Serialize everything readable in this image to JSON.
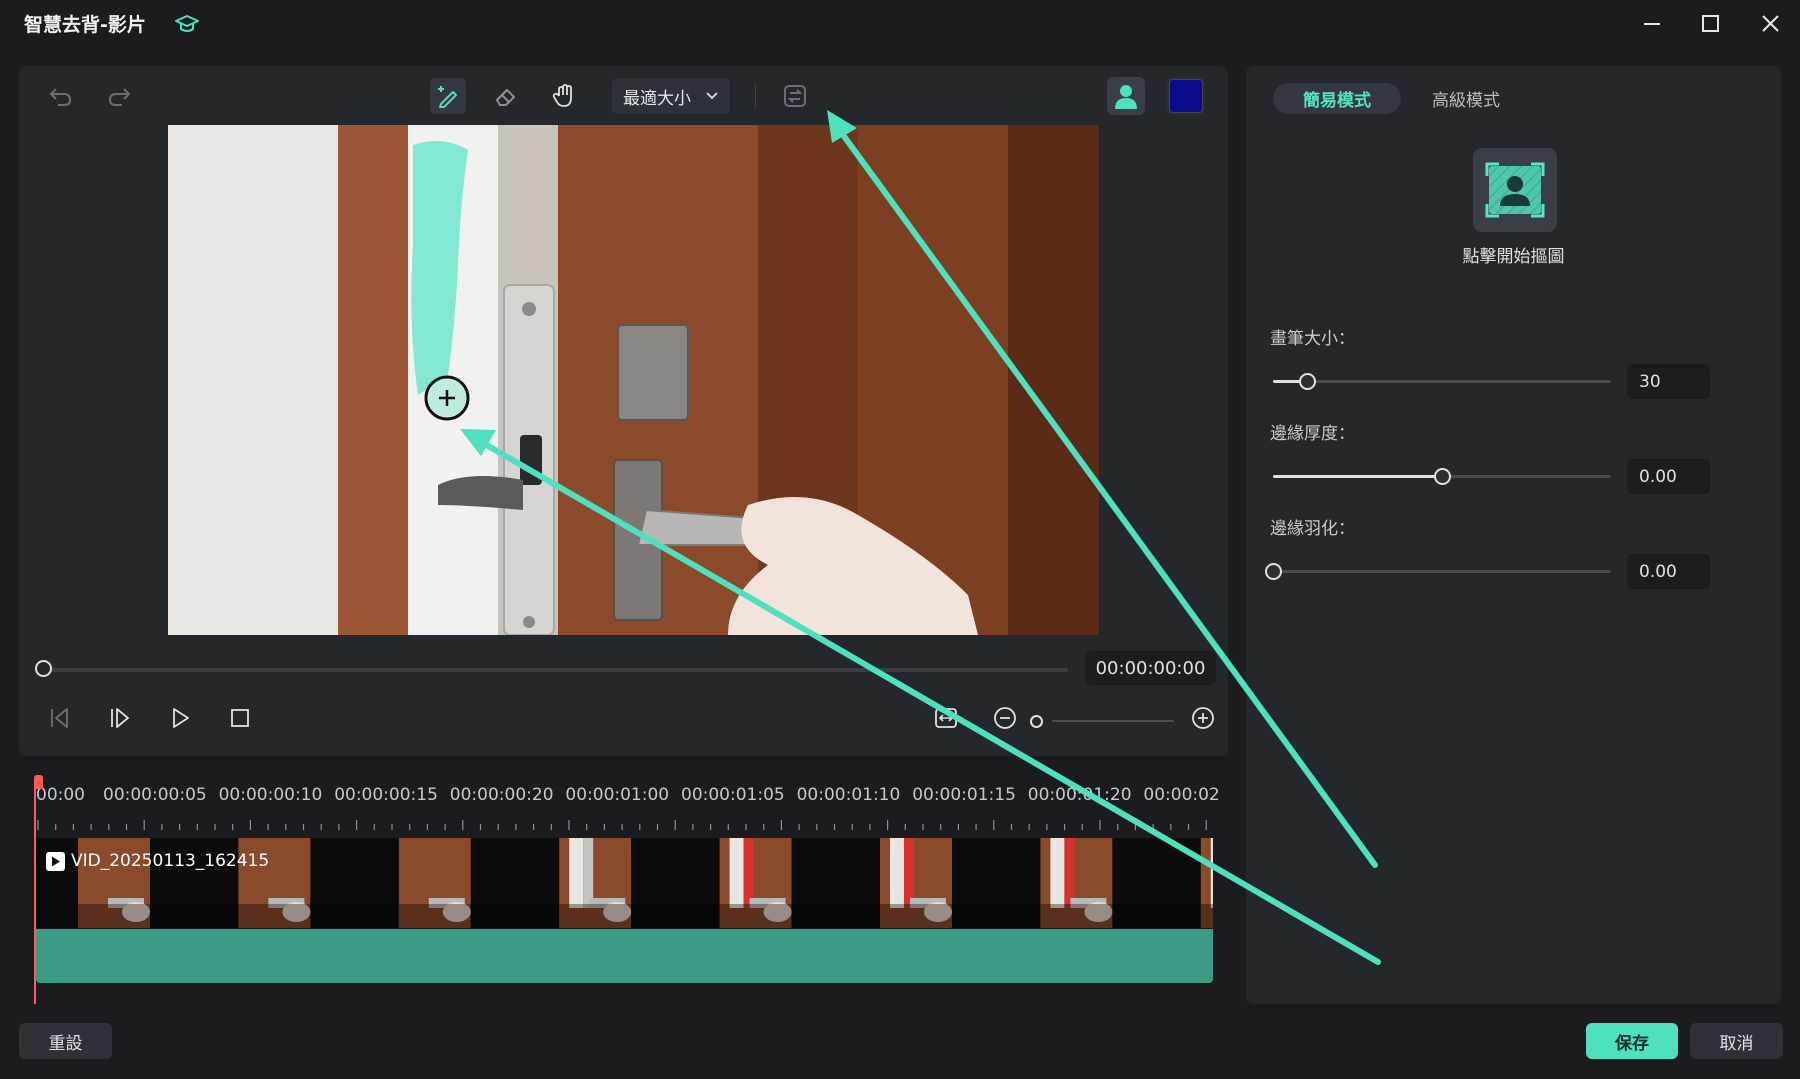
{
  "window": {
    "title": "智慧去背-影片"
  },
  "toolbar": {
    "zoom_value": "最適大小"
  },
  "colors": {
    "accent": "#4fe0bd",
    "background_color_swatch": "#0a0a8a",
    "playhead": "#ff5a5a",
    "annotation_arrow": "#4fe0bd",
    "brush_stroke": "#6fe6cc"
  },
  "playback": {
    "timecode": "00:00:00:00"
  },
  "timeline": {
    "ruler_labels": [
      "00:00",
      "00:00:00:05",
      "00:00:00:10",
      "00:00:00:15",
      "00:00:00:20",
      "00:00:01:00",
      "00:00:01:05",
      "00:00:01:10",
      "00:00:01:15",
      "00:00:01:20",
      "00:00:02"
    ],
    "clip_name": "VID_20250113_162415"
  },
  "right_panel": {
    "tabs": [
      {
        "label": "簡易模式",
        "active": true
      },
      {
        "label": "高級模式",
        "active": false
      }
    ],
    "cutout_label": "點擊開始摳圖",
    "sliders": [
      {
        "label": "畫筆大小：",
        "value": "30",
        "fraction": 0.1
      },
      {
        "label": "邊緣厚度：",
        "value": "0.00",
        "fraction": 0.5
      },
      {
        "label": "邊緣羽化：",
        "value": "0.00",
        "fraction": 0.0
      }
    ]
  },
  "footer": {
    "reset_label": "重設",
    "save_label": "保存",
    "cancel_label": "取消"
  }
}
